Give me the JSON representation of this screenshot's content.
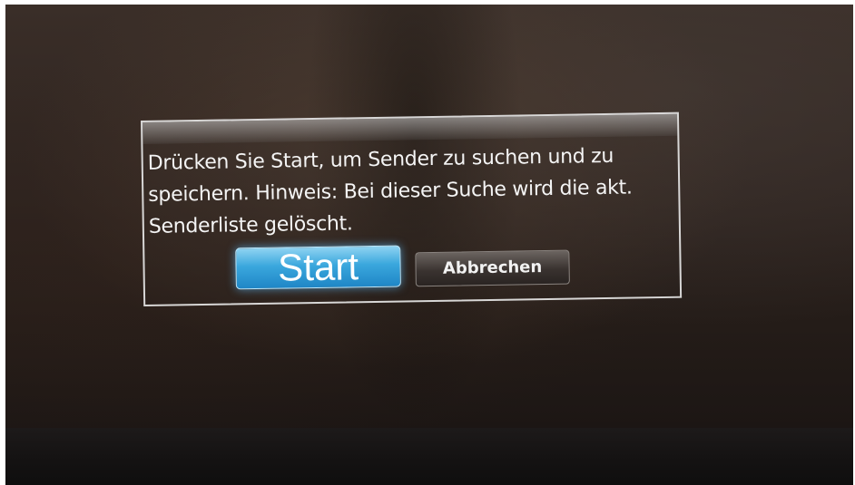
{
  "dialog": {
    "message_lines": [
      "Drücken Sie Start, um Sender zu suchen und zu",
      "speichern. Hinweis: Bei dieser Suche wird die akt.",
      "Senderliste gelöscht."
    ],
    "start_label": "Start",
    "cancel_label": "Abbrechen"
  },
  "colors": {
    "start_button": "#3aa7dd",
    "cancel_button": "#3a3330",
    "dialog_border": "#e6e6e6",
    "text": "#f4f4f4"
  }
}
